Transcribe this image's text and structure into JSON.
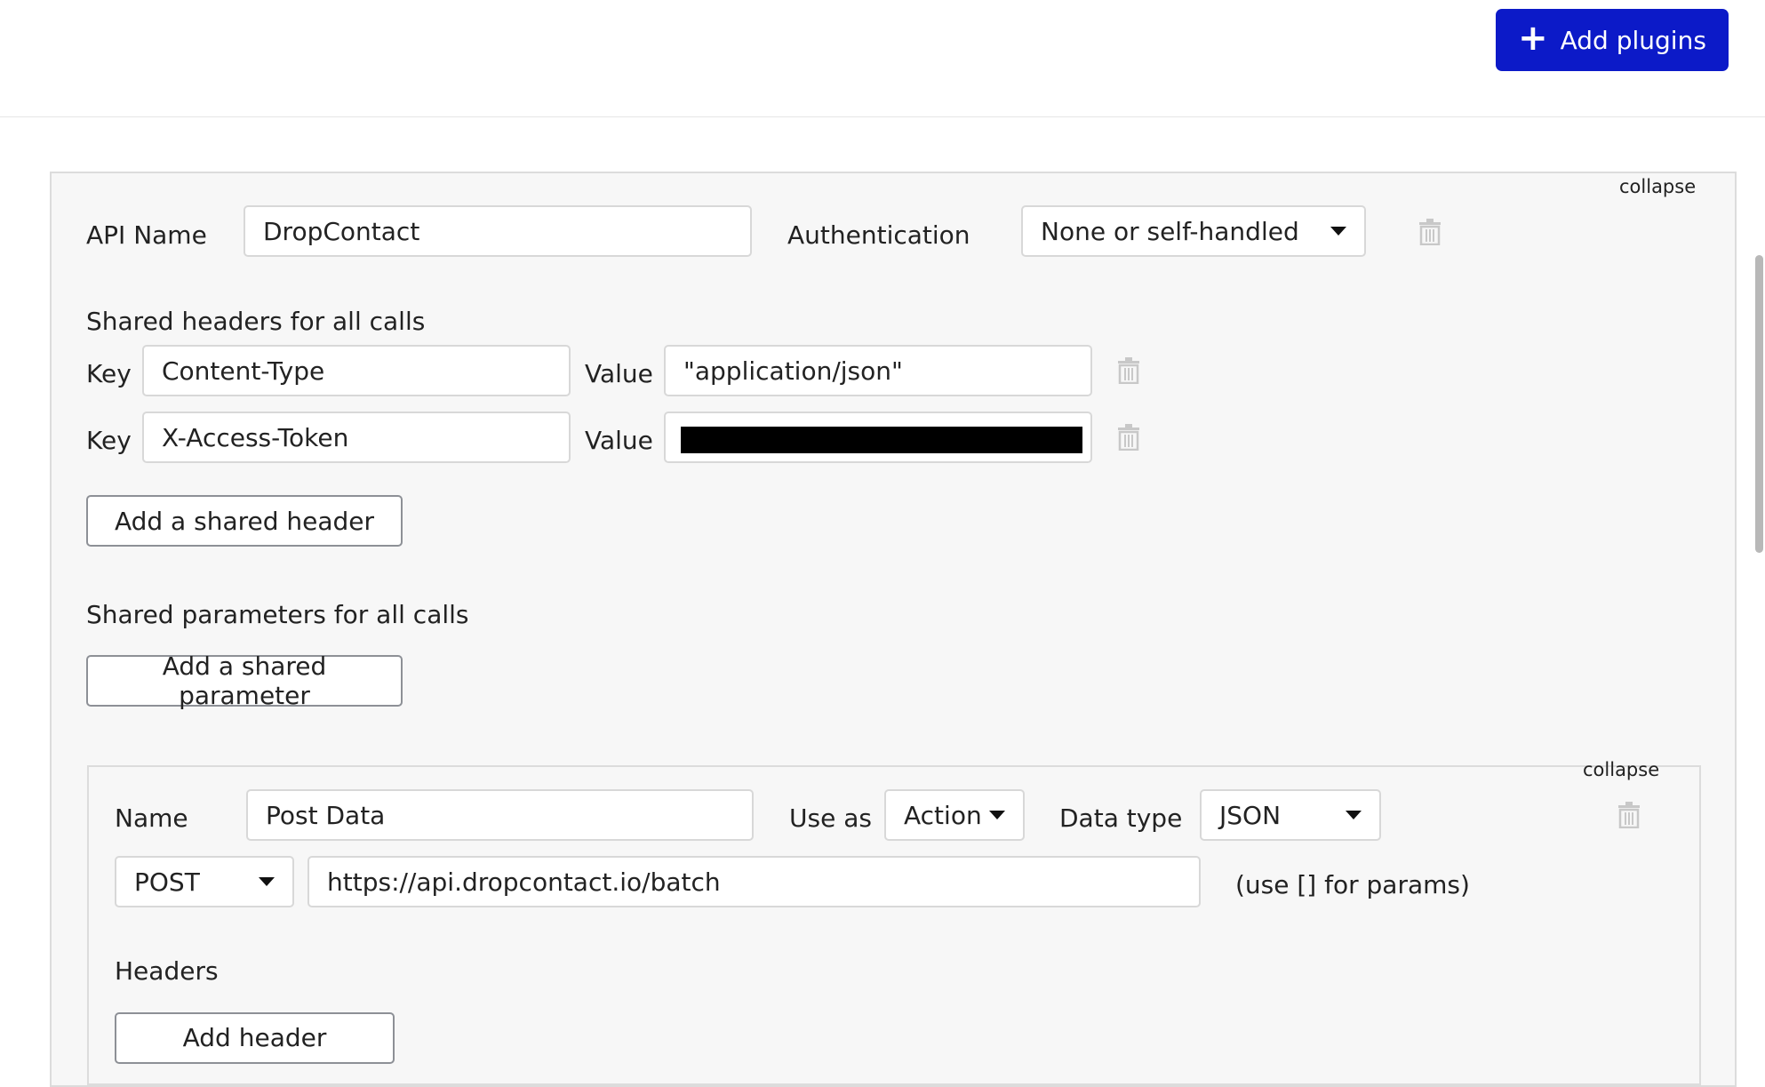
{
  "header": {
    "add_plugins_label": "Add plugins"
  },
  "api": {
    "collapse_label": "collapse",
    "api_name_label": "API Name",
    "api_name_value": "DropContact",
    "authentication_label": "Authentication",
    "authentication_value": "None or self-handled",
    "shared_headers_title": "Shared headers for all calls",
    "headers": [
      {
        "key_label": "Key",
        "key": "Content-Type",
        "value_label": "Value",
        "value": "\"application/json\""
      },
      {
        "key_label": "Key",
        "key": "X-Access-Token",
        "value_label": "Value",
        "value": ""
      }
    ],
    "add_shared_header_label": "Add a shared header",
    "shared_params_title": "Shared parameters for all calls",
    "add_shared_param_label": "Add a shared parameter"
  },
  "call": {
    "collapse_label": "collapse",
    "name_label": "Name",
    "name_value": "Post Data",
    "use_as_label": "Use as",
    "use_as_value": "Action",
    "data_type_label": "Data type",
    "data_type_value": "JSON",
    "method_value": "POST",
    "url_value": "https://api.dropcontact.io/batch",
    "params_hint": "(use [] for params)",
    "headers_title": "Headers",
    "add_header_label": "Add header"
  },
  "icons": {
    "trash": "trash-icon",
    "caret": "caret-down-icon",
    "plus": "plus-icon"
  }
}
